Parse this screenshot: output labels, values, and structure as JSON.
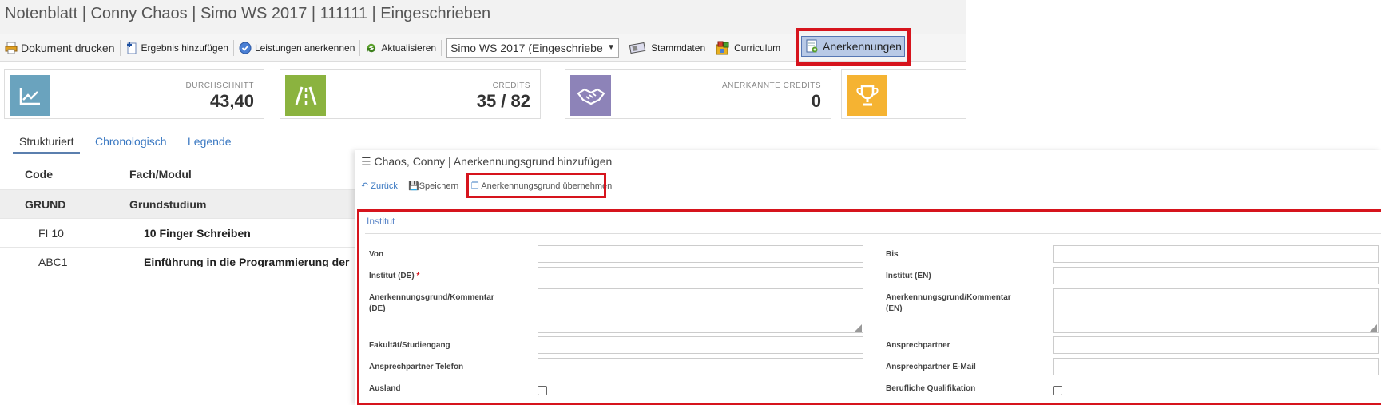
{
  "page": {
    "title": "Notenblatt | Conny Chaos | Simo WS 2017 | 111111 | Eingeschrieben"
  },
  "toolbar": {
    "print_label": "Dokument drucken",
    "add_result_label": "Ergebnis hinzufügen",
    "acknowledge_label": "Leistungen anerkennen",
    "refresh_label": "Aktualisieren",
    "semester_select_value": "Simo WS 2017 (Eingeschriebe",
    "stammdaten_label": "Stammdaten",
    "curriculum_label": "Curriculum",
    "anerkennungen_label": "Anerkennungen",
    "icons": {
      "print": "printer-icon",
      "add_result": "add-document-icon",
      "acknowledge": "checkmark-circle-icon",
      "refresh": "refresh-icon",
      "stammdaten": "id-card-icon",
      "curriculum": "curriculum-icon",
      "anerkennungen": "certificate-icon"
    }
  },
  "stats": [
    {
      "label": "DURCHSCHNITT",
      "value": "43,40",
      "icon": "chart-line-icon",
      "color": "#6aa3be"
    },
    {
      "label": "CREDITS",
      "value": "35 / 82",
      "icon": "road-icon",
      "color": "#8bb33f"
    },
    {
      "label": "ANERKANNTE CREDITS",
      "value": "0",
      "icon": "handshake-icon",
      "color": "#8d83b8"
    },
    {
      "label": "",
      "value": "",
      "icon": "trophy-icon",
      "color": "#f5b332"
    }
  ],
  "tabs": {
    "structured": "Strukturiert",
    "chronological": "Chronologisch",
    "legend": "Legende"
  },
  "grades_table": {
    "headers": {
      "code": "Code",
      "subject": "Fach/Modul"
    },
    "group": {
      "code": "GRUND",
      "subject": "Grundstudium"
    },
    "rows": [
      {
        "code": "FI 10",
        "subject": "10 Finger Schreiben"
      },
      {
        "code": "ABC1",
        "subject": "Einführung in die Programmierung der"
      }
    ]
  },
  "dialog": {
    "title": "Chaos, Conny | Anerkennungsgrund hinzufügen",
    "back_label": "Zurück",
    "save_label": "Speichern",
    "apply_reason_label": "Anerkennungsgrund übernehmen",
    "section_title": "Institut",
    "fields": {
      "von": "Von",
      "bis": "Bis",
      "institut_de": "Institut (DE)",
      "required_marker": "*",
      "institut_en": "Institut (EN)",
      "reason_de": "Anerkennungsgrund/Kommentar (DE)",
      "reason_en": "Anerkennungsgrund/Kommentar (EN)",
      "faculty": "Fakultät/Studiengang",
      "contact": "Ansprechpartner",
      "contact_phone": "Ansprechpartner Telefon",
      "contact_email": "Ansprechpartner E-Mail",
      "abroad": "Ausland",
      "professional": "Berufliche Qualifikation"
    }
  },
  "colors": {
    "highlight_red": "#d6141d",
    "link_blue": "#3a78c2"
  }
}
